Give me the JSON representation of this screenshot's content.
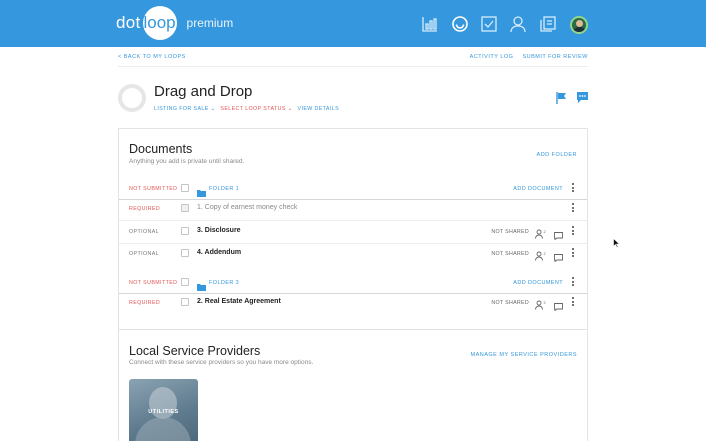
{
  "app": {
    "logo_left": "dot",
    "logo_circle": "loop",
    "logo_tier": "premium",
    "brand_color": "#3597dd"
  },
  "nav": {
    "icons": [
      "bar-chart-icon",
      "loops-icon",
      "tasks-icon",
      "profile-icon",
      "templates-icon",
      "avatar"
    ]
  },
  "subheader": {
    "back_label": "< BACK TO MY LOOPS",
    "activity_log": "ACTIVITY LOG",
    "submit_review": "SUBMIT FOR REVIEW"
  },
  "loop": {
    "title": "Drag and Drop",
    "type_label": "LISTING FOR SALE",
    "status_label": "SELECT LOOP STATUS",
    "view_details": "VIEW DETAILS"
  },
  "documents": {
    "title": "Documents",
    "subtitle": "Anything you add is private until shared.",
    "add_folder": "ADD FOLDER",
    "add_document": "ADD DOCUMENT",
    "not_shared": "NOT SHARED",
    "folders": [
      {
        "status": "NOT SUBMITTED",
        "name": "FOLDER 1",
        "docs": [
          {
            "status": "REQUIRED",
            "name": "1. Copy of earnest money check",
            "shared": ""
          },
          {
            "status": "OPTIONAL",
            "name": "3. Disclosure",
            "shared": "NOT SHARED"
          },
          {
            "status": "OPTIONAL",
            "name": "4. Addendum",
            "shared": "NOT SHARED"
          }
        ]
      },
      {
        "status": "NOT SUBMITTED",
        "name": "FOLDER 3",
        "docs": [
          {
            "status": "REQUIRED",
            "name": "2. Real Estate Agreement",
            "shared": "NOT SHARED"
          }
        ]
      }
    ]
  },
  "providers": {
    "title": "Local Service Providers",
    "subtitle": "Connect with these service providers so you have more options.",
    "manage": "MANAGE MY SERVICE PROVIDERS",
    "tiles": [
      {
        "label": "UTILITIES"
      }
    ]
  }
}
